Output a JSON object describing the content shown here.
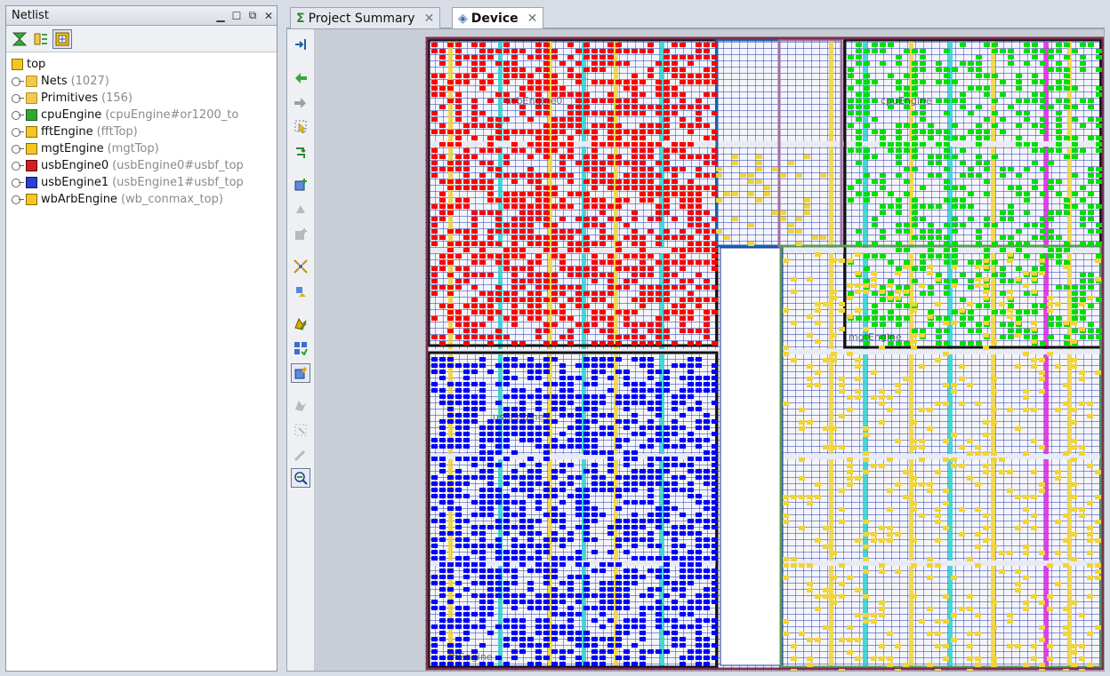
{
  "netlist": {
    "title": "Netlist",
    "window_controls": [
      "minimize-icon",
      "maximize-icon",
      "float-icon",
      "close-icon"
    ],
    "toolbar": [
      "collapse-all-icon",
      "expand-all-icon",
      "show-hierarchy-icon"
    ],
    "tree": {
      "root": "top",
      "items": [
        {
          "label": "Nets",
          "detail": "(1027)",
          "icon": "folder-icon",
          "color": "#f2c94c"
        },
        {
          "label": "Primitives",
          "detail": "(156)",
          "icon": "folder-icon",
          "color": "#f2c94c"
        },
        {
          "label": "cpuEngine",
          "detail": "(cpuEngine#or1200_to",
          "icon": "cell-icon",
          "color": "#2eaa2e"
        },
        {
          "label": "fftEngine",
          "detail": "(fftTop)",
          "icon": "cell-icon",
          "color": "#f3c623"
        },
        {
          "label": "mgtEngine",
          "detail": "(mgtTop)",
          "icon": "cell-icon",
          "color": "#f3c623"
        },
        {
          "label": "usbEngine0",
          "detail": "(usbEngine0#usbf_top",
          "icon": "cell-icon",
          "color": "#d02020"
        },
        {
          "label": "usbEngine1",
          "detail": "(usbEngine1#usbf_top",
          "icon": "cell-icon",
          "color": "#2c3fd0"
        },
        {
          "label": "wbArbEngine",
          "detail": "(wb_conmax_top)",
          "icon": "cell-icon",
          "color": "#f3c623"
        }
      ]
    }
  },
  "tabs": [
    {
      "label": "Project Summary",
      "icon": "sigma-icon",
      "active": false
    },
    {
      "label": "Device",
      "icon": "device-icon",
      "active": true
    }
  ],
  "device_toolbar": [
    "auto-fit-icon",
    "back-arrow-icon",
    "forward-arrow-icon",
    "select-icon",
    "route-icon",
    "add-pblock-icon",
    "pblock-icon",
    "pblock-add-icon",
    "fit-selection-icon",
    "move-icon",
    "mark-icon",
    "highlight-icon",
    "show-placed-icon",
    "unplace-icon",
    "unplace-cell-icon",
    "clear-icon",
    "zoom-icon"
  ],
  "device_labels": [
    {
      "text": "usbEngine0",
      "color": "#3a3a3a"
    },
    {
      "text": "cpuEngine",
      "color": "#3a3a3a"
    },
    {
      "text": "usbEngine1",
      "color": "#3a3a3a"
    },
    {
      "text": "mgtEngine",
      "color": "#3a3a3a"
    },
    {
      "text": "fftEngine",
      "color": "#3a3a3a"
    }
  ],
  "colors": {
    "usbEngine0": "#ff0000",
    "usbEngine1": "#0000ff",
    "cpuEngine": "#00e000",
    "fft_mgt": "#f0d438",
    "grid": "#1c2fb0"
  }
}
